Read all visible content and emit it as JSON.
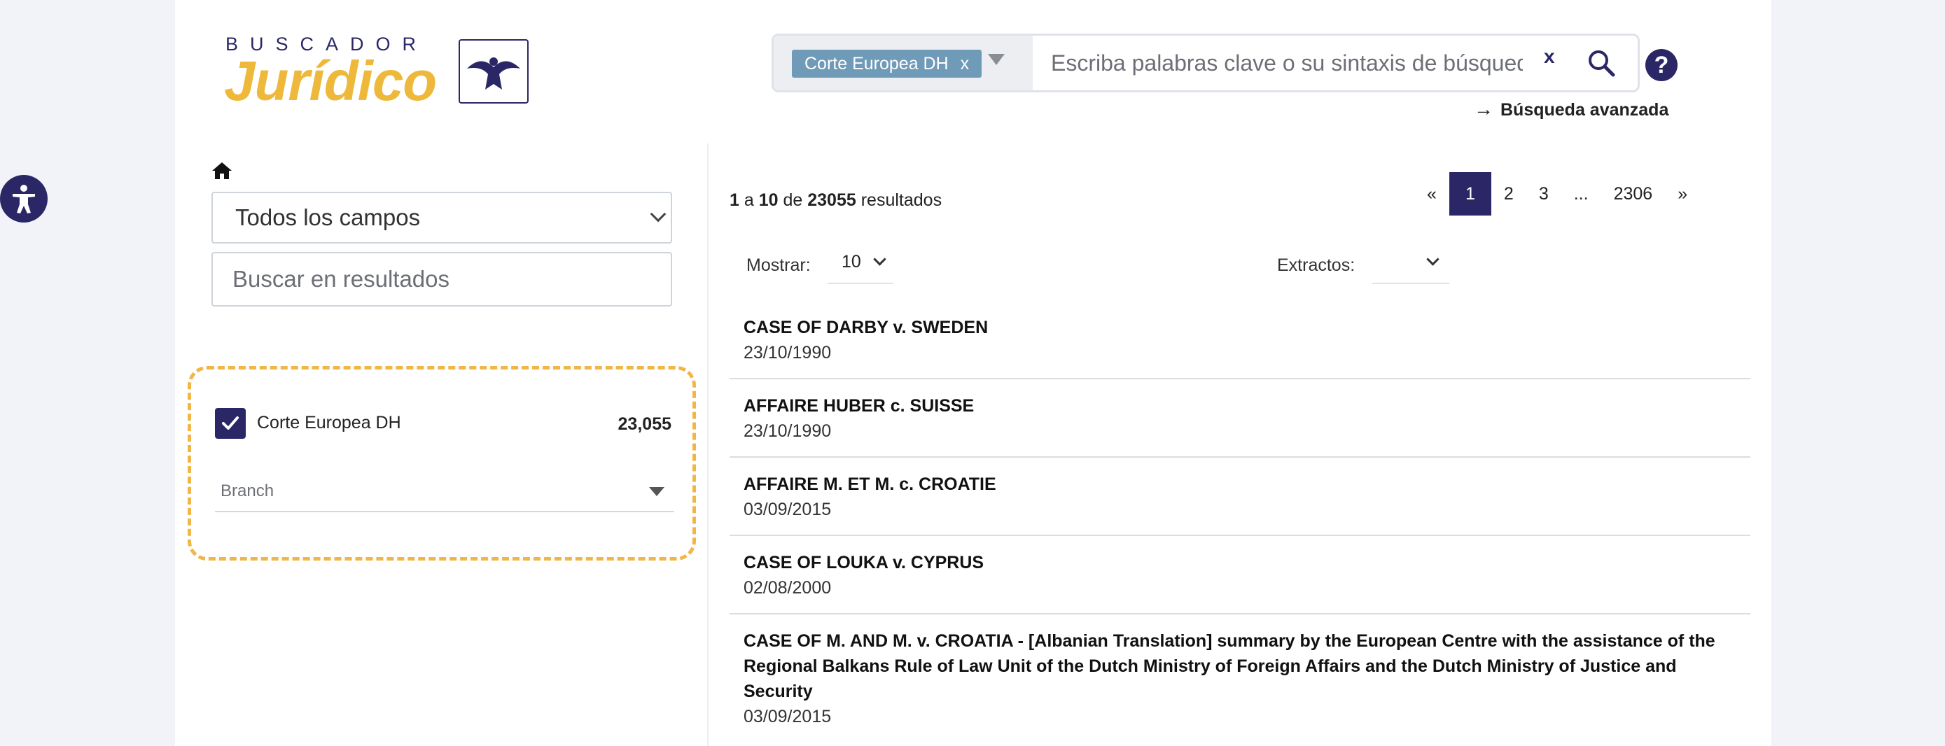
{
  "logo": {
    "top_text": "BUSCADOR",
    "main_text": "Jurídico"
  },
  "search": {
    "scope_tag": "Corte Europea DH",
    "scope_tag_remove": "x",
    "placeholder": "Escriba palabras clave o su sintaxis de búsqued",
    "clear_label": "x"
  },
  "help_label": "?",
  "advanced_search": {
    "arrow": "→",
    "label": "Búsqueda avanzada"
  },
  "sidebar": {
    "field_select": "Todos los campos",
    "filter_placeholder": "Buscar en resultados",
    "facet": {
      "label": "Corte Europea DH",
      "count": "23,055",
      "checked": true
    },
    "branch_label": "Branch"
  },
  "results": {
    "summary": {
      "from": "1",
      "a": "a",
      "to": "10",
      "de": "de",
      "total": "23055",
      "suffix": "resultados"
    },
    "pagination": [
      "«",
      "1",
      "2",
      "3",
      "...",
      "2306",
      "»"
    ],
    "active_page": "1",
    "show_label": "Mostrar:",
    "show_value": "10",
    "extracts_label": "Extractos:",
    "items": [
      {
        "title": "CASE OF DARBY v. SWEDEN",
        "date": "23/10/1990"
      },
      {
        "title": "AFFAIRE HUBER c. SUISSE",
        "date": "23/10/1990"
      },
      {
        "title": "AFFAIRE M. ET M. c. CROATIE",
        "date": "03/09/2015"
      },
      {
        "title": "CASE OF LOUKA v. CYPRUS",
        "date": "02/08/2000"
      },
      {
        "title": "CASE OF M. AND M. v. CROATIA - [Albanian Translation] summary by the European Centre with the assistance of the Regional Balkans Rule of Law Unit of the Dutch Ministry of Foreign Affairs and the Dutch Ministry of Justice and Security",
        "date": "03/09/2015"
      }
    ]
  },
  "colors": {
    "brand_navy": "#2b2766",
    "brand_gold": "#eeb93b",
    "tag_blue": "#6f9ab8",
    "highlight_dashed": "#f0b646"
  }
}
